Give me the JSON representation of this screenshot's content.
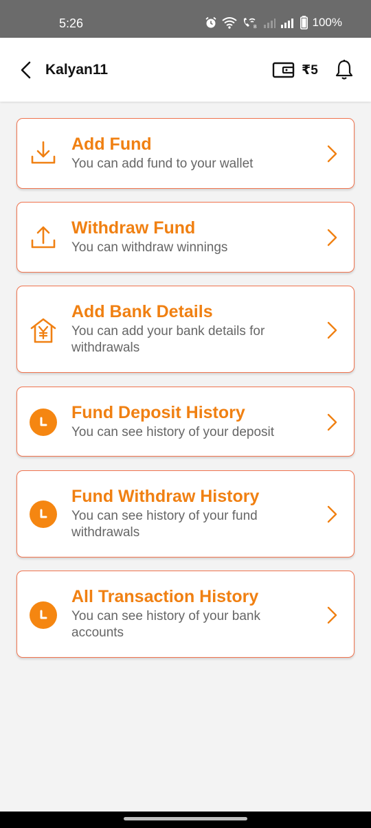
{
  "status_bar": {
    "time": "5:26",
    "battery": "100%"
  },
  "header": {
    "title": "Kalyan11",
    "wallet_balance": "₹5"
  },
  "menu": [
    {
      "icon": "download-icon",
      "title": "Add Fund",
      "subtitle": "You can add fund to your wallet"
    },
    {
      "icon": "upload-icon",
      "title": "Withdraw Fund",
      "subtitle": "You can withdraw winnings"
    },
    {
      "icon": "bank-icon",
      "title": "Add Bank Details",
      "subtitle": "You can add your bank details for withdrawals"
    },
    {
      "icon": "clock-icon",
      "title": "Fund Deposit History",
      "subtitle": "You can see history of your deposit"
    },
    {
      "icon": "clock-icon",
      "title": "Fund Withdraw History",
      "subtitle": "You can see history of your fund withdrawals"
    },
    {
      "icon": "clock-icon",
      "title": "All Transaction History",
      "subtitle": "You can see history of your bank accounts"
    }
  ],
  "colors": {
    "accent": "#f08012",
    "card_border": "#f0734e",
    "status_bar": "#6b6b6b"
  }
}
